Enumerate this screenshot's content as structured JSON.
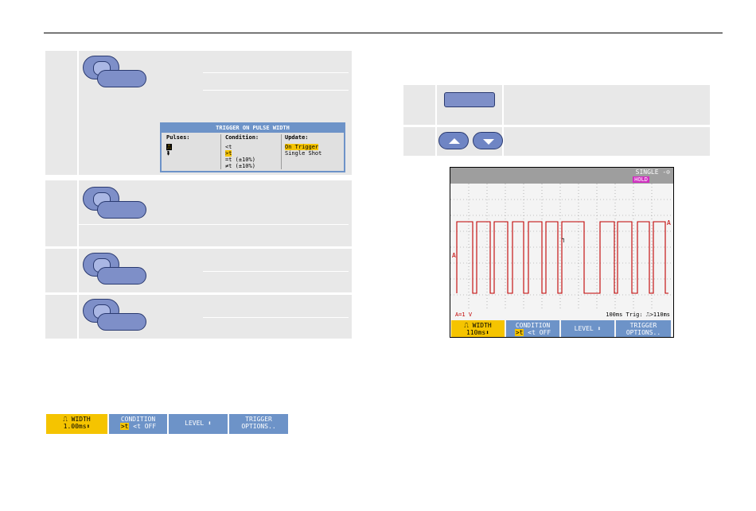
{
  "popup": {
    "title": "TRIGGER ON PULSE WIDTH",
    "pulses_header": "Pulses:",
    "pulse_pos": "⎍",
    "pulse_neg": "⮯",
    "condition_header": "Condition:",
    "conditions": [
      "<t",
      ">t",
      "=t (±10%)",
      "≠t (±10%)"
    ],
    "update_header": "Update:",
    "update_selected": "On Trigger",
    "update_other": "Single Shot"
  },
  "softkeys_left": {
    "width_label": "⎍ WIDTH",
    "width_value": "1.00ms⬍",
    "condition_label": "CONDITION",
    "condition_sel": ">t",
    "condition_rest": "<t  OFF",
    "level_label": "LEVEL ⬍",
    "trigger_l1": "TRIGGER",
    "trigger_l2": "OPTIONS.."
  },
  "scope": {
    "mode": "SINGLE -⊙",
    "hold": "HOLD",
    "marker_a": "A",
    "scale_a": "A=1 V",
    "status": "100ms Trig: ⎍>110ms"
  },
  "softkeys_scope": {
    "width_label": "⎍ WIDTH",
    "width_value": "110ms⬍",
    "condition_label": "CONDITION",
    "condition_sel": ">t",
    "condition_rest": "<t  OFF",
    "level_label": "LEVEL ⬍",
    "trigger_l1": "TRIGGER",
    "trigger_l2": "OPTIONS.."
  },
  "colors": {
    "panel": "#e8e8e8",
    "key_blue": "#7e8fc8",
    "softkey_blue": "#6d93c8",
    "highlight": "#f5c400",
    "trace": "#c00000"
  }
}
